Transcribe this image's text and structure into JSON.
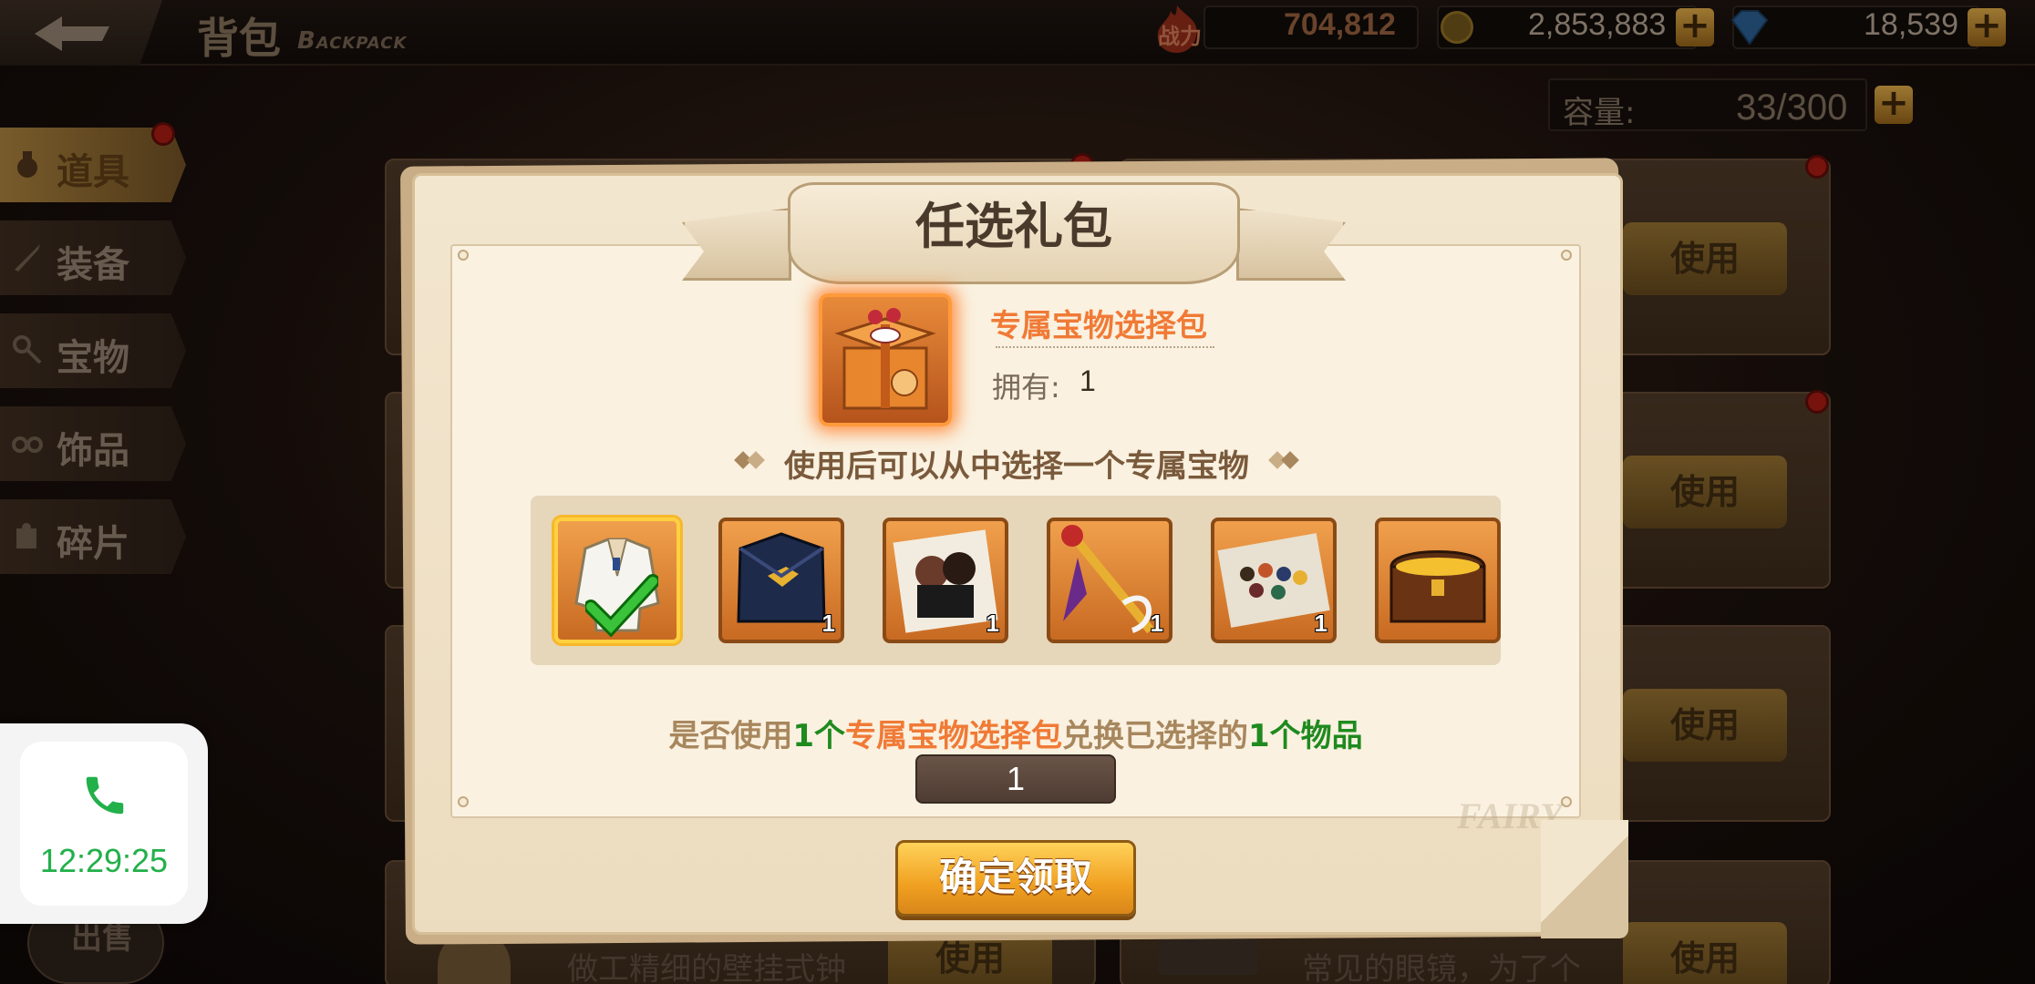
{
  "header": {
    "title_cn": "背包",
    "title_en": "Backpack",
    "power_label": "战力",
    "power_value": "704,812",
    "gold_value": "2,853,883",
    "gem_value": "18,539",
    "plus_symbol": "+"
  },
  "capacity": {
    "label": "容量:",
    "value": "33/300"
  },
  "sidebar": {
    "items": [
      {
        "label": "道具",
        "icon": "bag-icon",
        "active": true
      },
      {
        "label": "装备",
        "icon": "sword-icon",
        "active": false
      },
      {
        "label": "宝物",
        "icon": "key-icon",
        "active": false
      },
      {
        "label": "饰品",
        "icon": "glasses-icon",
        "active": false
      },
      {
        "label": "碎片",
        "icon": "puzzle-icon",
        "active": false
      }
    ]
  },
  "background": {
    "use_label": "使用",
    "item_desc_left": "做工精细的壁挂式钟",
    "item_desc_right": "常见的眼镜，为了个",
    "sell_label": "出售"
  },
  "call_widget": {
    "time": "12:29:25",
    "icon": "phone-icon"
  },
  "modal": {
    "title": "任选礼包",
    "item_name": "专属宝物选择包",
    "own_label": "拥有:",
    "own_value": "1",
    "hint": "使用后可以从中选择一个专属宝物",
    "options": [
      {
        "name": "white-coat-treasure",
        "count": "",
        "selected": true
      },
      {
        "name": "dark-cloak-treasure",
        "count": "1",
        "selected": false
      },
      {
        "name": "portrait-treasure",
        "count": "1",
        "selected": false
      },
      {
        "name": "staff-treasure",
        "count": "1",
        "selected": false
      },
      {
        "name": "group-photo-treasure",
        "count": "1",
        "selected": false
      },
      {
        "name": "treasure-chest",
        "count": "",
        "selected": false
      }
    ],
    "confirm": {
      "p1": "是否使用",
      "p2": "1个",
      "p3": "专属宝物选择包",
      "p4": "兑换已选择的",
      "p5": "1个物品"
    },
    "quantity": "1",
    "claim_button": "确定领取",
    "watermark": "FAIRY"
  },
  "colors": {
    "accent_orange": "#f07a36",
    "accent_green": "#1f8a1f",
    "text_brown": "#7a5a3c",
    "call_green": "#22b04a"
  }
}
